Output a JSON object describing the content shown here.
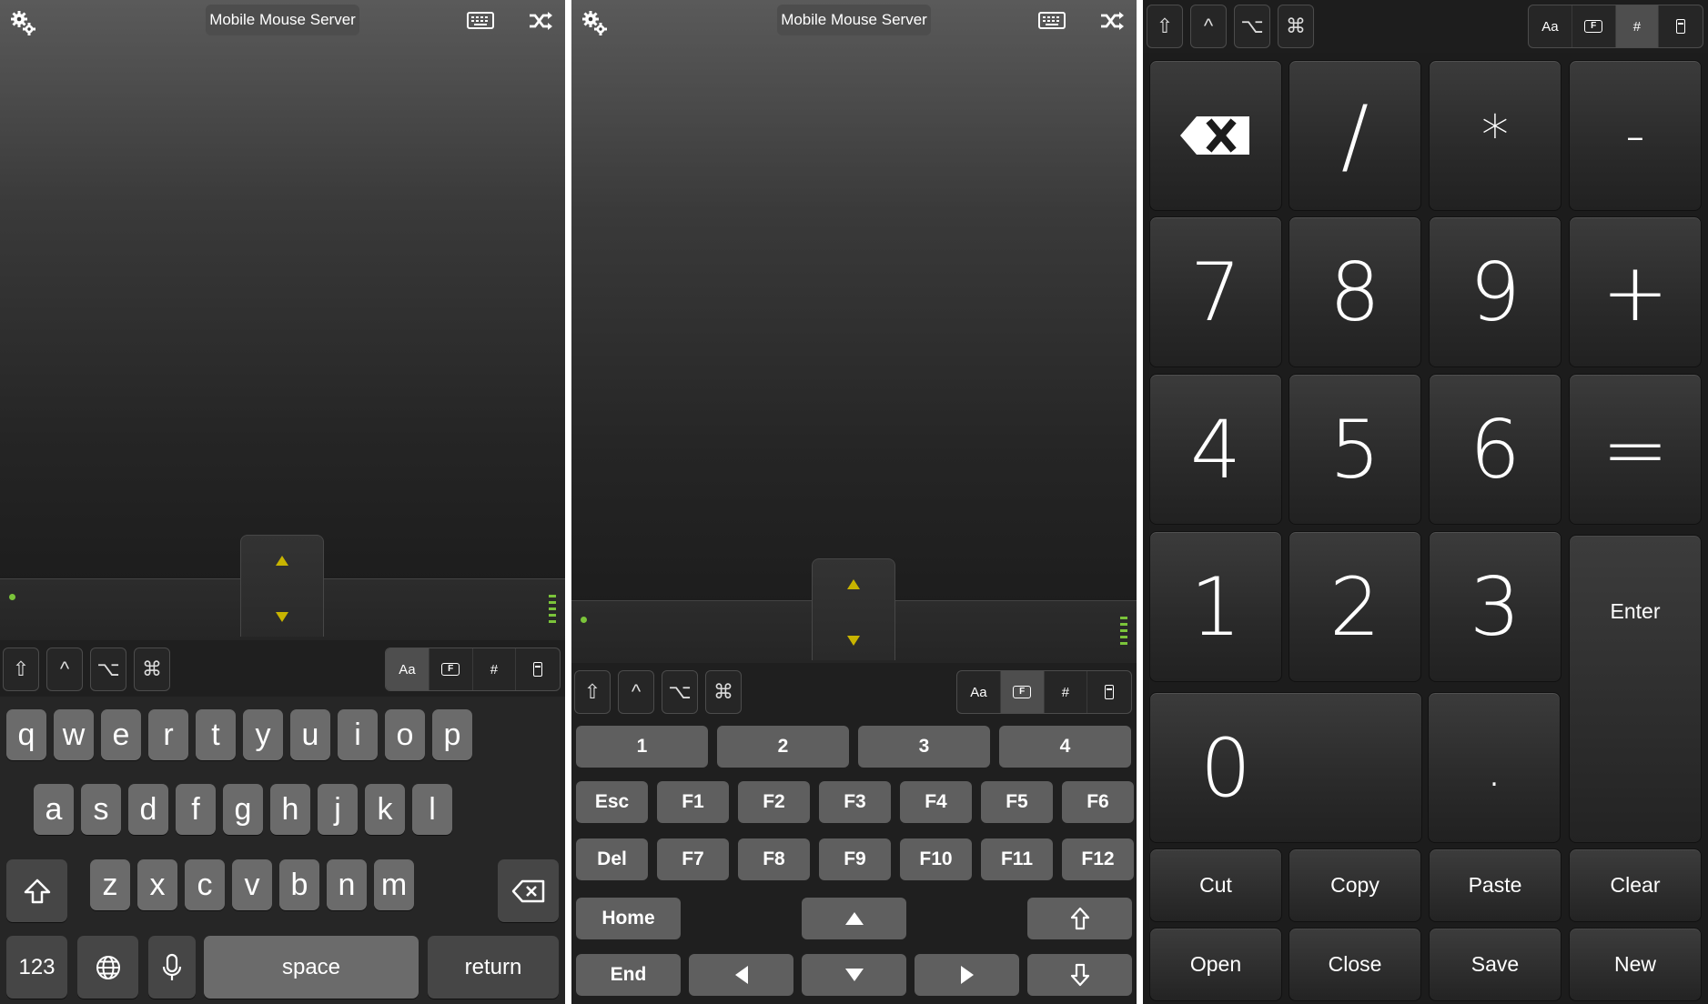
{
  "server_name": "Mobile Mouse Server",
  "modifiers": [
    "⇧",
    "^",
    "⌥",
    "⌘"
  ],
  "modes": {
    "text": "Aa",
    "function": "F",
    "numeric": "#"
  },
  "keyboard": {
    "row1": [
      "q",
      "w",
      "e",
      "r",
      "t",
      "y",
      "u",
      "i",
      "o",
      "p"
    ],
    "row2": [
      "a",
      "s",
      "d",
      "f",
      "g",
      "h",
      "j",
      "k",
      "l"
    ],
    "row3": [
      "z",
      "x",
      "c",
      "v",
      "b",
      "n",
      "m"
    ],
    "numbers_label": "123",
    "space_label": "space",
    "return_label": "return"
  },
  "function_keys": {
    "number_row": [
      "1",
      "2",
      "3",
      "4"
    ],
    "f_row1": [
      "Esc",
      "F1",
      "F2",
      "F3",
      "F4",
      "F5",
      "F6"
    ],
    "f_row2": [
      "Del",
      "F7",
      "F8",
      "F9",
      "F10",
      "F11",
      "F12"
    ],
    "home_label": "Home",
    "end_label": "End"
  },
  "numpad": {
    "row1": [
      "/",
      "*",
      "-"
    ],
    "row2": [
      "7",
      "8",
      "9",
      "+"
    ],
    "row3": [
      "4",
      "5",
      "6",
      "="
    ],
    "row4": [
      "1",
      "2",
      "3"
    ],
    "enter_label": "Enter",
    "zero": "0",
    "dot": ".",
    "edit_row": [
      "Cut",
      "Copy",
      "Paste",
      "Clear"
    ],
    "file_row": [
      "Open",
      "Close",
      "Save",
      "New"
    ]
  },
  "colors": {
    "accent_green": "#7bc43a",
    "scroll_arrow": "#c8b400"
  },
  "icons": [
    "gear-icon",
    "keyboard-icon",
    "shuffle-icon",
    "backspace-icon",
    "globe-icon",
    "microphone-icon",
    "shift-icon",
    "card-icon"
  ]
}
